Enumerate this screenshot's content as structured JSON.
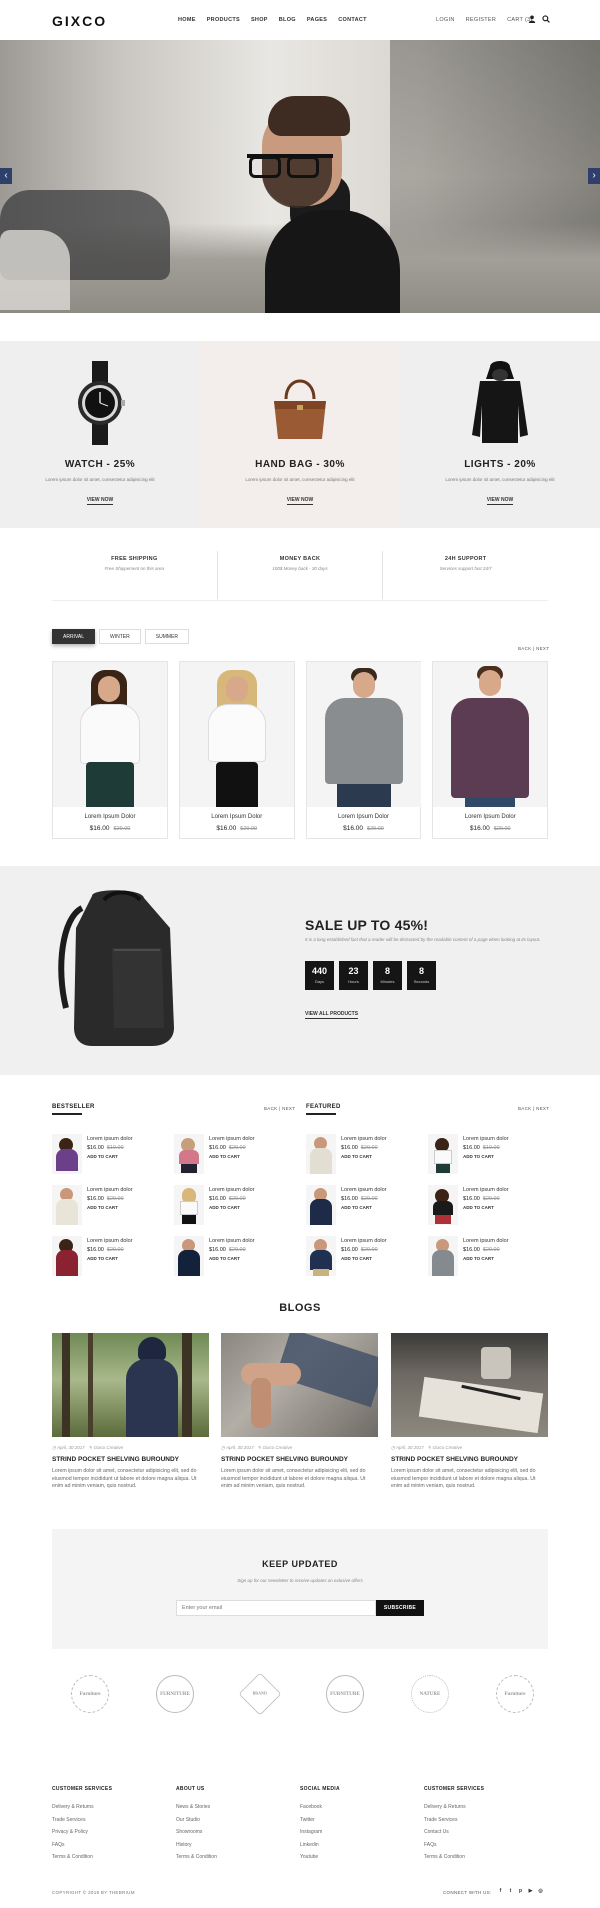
{
  "header": {
    "logo": "GIXCO",
    "nav": [
      "HOME",
      "PRODUCTS",
      "SHOP",
      "BLOG",
      "PAGES",
      "CONTACT"
    ],
    "login": "LOGIN",
    "register": "REGISTER",
    "cart": "CART (3)"
  },
  "hero": {
    "prev": "‹",
    "next": "›"
  },
  "categories": [
    {
      "title": "WATCH - 25%",
      "desc": "Lorem ipsum dolor sit amet, consectetur adipisicing elit",
      "link": "VIEW NOW"
    },
    {
      "title": "HAND BAG - 30%",
      "desc": "Lorem ipsum dolor sit amet, consectetur adipisicing elit",
      "link": "VIEW NOW"
    },
    {
      "title": "LIGHTS - 20%",
      "desc": "Lorem ipsum dolor sit amet, consectetur adipisicing elit",
      "link": "VIEW NOW"
    }
  ],
  "features": [
    {
      "title": "FREE SHIPPING",
      "sub": "Free Shippement on this area"
    },
    {
      "title": "MONEY BACK",
      "sub": "100$ Money back - 30 days"
    },
    {
      "title": "24H SUPPORT",
      "sub": "Services support fast 24/7"
    }
  ],
  "tabs": [
    "ARRIVAL",
    "WINTER",
    "SUMMER"
  ],
  "pager": {
    "back": "BACK",
    "sep": "|",
    "next": "NEXT"
  },
  "products": [
    {
      "name": "Lorem Ipsum Dolor",
      "price": "$16.00",
      "old": "$29.00"
    },
    {
      "name": "Lorem Ipsum Dolor",
      "price": "$16.00",
      "old": "$29.00"
    },
    {
      "name": "Lorem Ipsum Dolor",
      "price": "$16.00",
      "old": "$29.00"
    },
    {
      "name": "Lorem Ipsum Dolor",
      "price": "$16.00",
      "old": "$29.00"
    }
  ],
  "sale": {
    "title": "SALE UP TO 45%!",
    "desc": "It is a long established fact that a reader will be distracted by the readable content of a page when looking at its layout.",
    "countdown": [
      {
        "n": "440",
        "l": "Days"
      },
      {
        "n": "23",
        "l": "Hours"
      },
      {
        "n": "8",
        "l": "Minutes"
      },
      {
        "n": "8",
        "l": "Seconds"
      }
    ],
    "view_all": "VIEW ALL PRODUCTS"
  },
  "bestseller": {
    "title": "BESTSELLER",
    "items": [
      {
        "name": "Lorem ipsum dolor",
        "price": "$16.00",
        "old": "$19.00",
        "add": "ADD TO CART"
      },
      {
        "name": "Lorem ipsum dolor",
        "price": "$16.00",
        "old": "$29.00",
        "add": "ADD TO CART"
      },
      {
        "name": "Lorem ipsum dolor",
        "price": "$16.00",
        "old": "$29.00",
        "add": "ADD TO CART"
      },
      {
        "name": "Lorem ipsum dolor",
        "price": "$16.00",
        "old": "$29.00",
        "add": "ADD TO CART"
      },
      {
        "name": "Lorem ipsum dolor",
        "price": "$16.00",
        "old": "$29.00",
        "add": "ADD TO CART"
      },
      {
        "name": "Lorem ipsum dolor",
        "price": "$16.00",
        "old": "$29.00",
        "add": "ADD TO CART"
      }
    ]
  },
  "featured": {
    "title": "FEATURED",
    "items": [
      {
        "name": "Lorem ipsum dolor",
        "price": "$16.00",
        "old": "$29.00",
        "add": "ADD TO CART"
      },
      {
        "name": "Lorem ipsum dolor",
        "price": "$16.00",
        "old": "$19.00",
        "add": "ADD TO CART"
      },
      {
        "name": "Lorem ipsum dolor",
        "price": "$16.00",
        "old": "$29.00",
        "add": "ADD TO CART"
      },
      {
        "name": "Lorem ipsum dolor",
        "price": "$16.00",
        "old": "$29.00",
        "add": "ADD TO CART"
      },
      {
        "name": "Lorem ipsum dolor",
        "price": "$16.00",
        "old": "$29.00",
        "add": "ADD TO CART"
      },
      {
        "name": "Lorem ipsum dolor",
        "price": "$16.00",
        "old": "$29.00",
        "add": "ADD TO CART"
      }
    ]
  },
  "blogs": {
    "title": "BLOGS",
    "posts": [
      {
        "date": "April, 30 2017",
        "author": "Gixco Creative",
        "title": "STRIND POCKET SHELVING BUROUNDY",
        "desc": "Lorem ipsum dolor sit amet, consectetur adipisicing elit, sed do eiusmod tempor incididunt ut labore et dolore magna aliqua. Ut enim ad minim veniam, quis nostrud."
      },
      {
        "date": "April, 30 2017",
        "author": "Gixco Creative",
        "title": "STRIND POCKET SHELVING BUROUNDY",
        "desc": "Lorem ipsum dolor sit amet, consectetur adipisicing elit, sed do eiusmod tempor incididunt ut labore et dolore magna aliqua. Ut enim ad minim veniam, quis nostrud."
      },
      {
        "date": "April, 30 2017",
        "author": "Gixco Creative",
        "title": "STRIND POCKET SHELVING BUROUNDY",
        "desc": "Lorem ipsum dolor sit amet, consectetur adipisicing elit, sed do eiusmod tempor incididunt ut labore et dolore magna aliqua. Ut enim ad minim veniam, quis nostrud."
      }
    ]
  },
  "newsletter": {
    "title": "KEEP UPDATED",
    "sub": "Sign up for our newsletter to receive updates an exlusive offers",
    "placeholder": "Enter your email",
    "button": "SUBSCRIBE"
  },
  "brands": [
    "Furniture",
    "FURNITURE",
    "BRAND",
    "FURNITURE",
    "NATURE",
    "Furniture"
  ],
  "footer": {
    "columns": [
      {
        "title": "CUSTOMER SERVICES",
        "links": [
          "Delivery & Returns",
          "Trade Services",
          "Privacy & Policy",
          "FAQs",
          "Terms & Condition"
        ]
      },
      {
        "title": "ABOUT US",
        "links": [
          "News & Stories",
          "Our Studio",
          "Showrooms",
          "History",
          "Terms & Condition"
        ]
      },
      {
        "title": "SOCIAL MEDIA",
        "links": [
          "Facebook",
          "Twitter",
          "Instagram",
          "Linkedin",
          "Youtube"
        ]
      },
      {
        "title": "CUSTOMER SERVICES",
        "links": [
          "Delivery & Returns",
          "Trade Services",
          "Contact Us",
          "FAQs",
          "Terms & Condition"
        ]
      }
    ],
    "copyright": "COPYRIGHT © 2019 BY THEBRIUM",
    "connect": "CONNECT WITH US:",
    "social": [
      "f",
      "t",
      "p",
      "▶",
      "◎"
    ]
  }
}
